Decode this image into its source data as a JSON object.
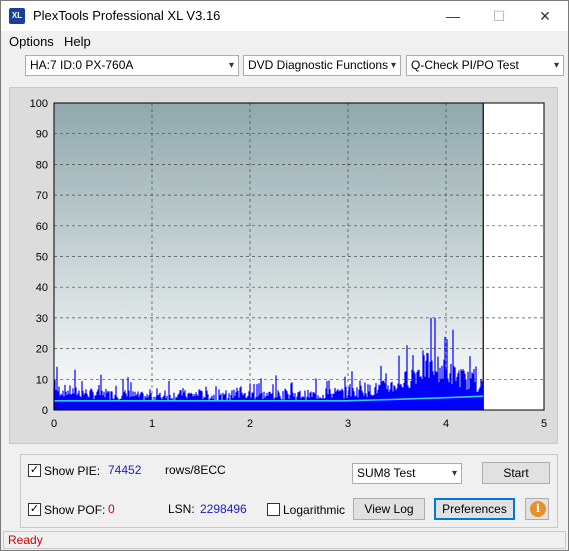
{
  "window": {
    "title": "PlexTools Professional XL V3.16",
    "icon_label": "XL",
    "minimize_glyph": "—",
    "maximize_glyph": "☐",
    "close_glyph": "✕"
  },
  "menu": {
    "options": "Options",
    "help": "Help"
  },
  "toolbar": {
    "drive": "HA:7 ID:0  PX-760A",
    "function": "DVD Diagnostic Functions",
    "test": "Q-Check PI/PO Test",
    "arrow": "▾"
  },
  "chart_data": {
    "type": "area",
    "x_range": [
      0,
      5
    ],
    "y_range": [
      0,
      100
    ],
    "x_ticks": [
      "0",
      "1",
      "2",
      "3",
      "4",
      "5"
    ],
    "y_ticks": [
      "0",
      "10",
      "20",
      "30",
      "40",
      "50",
      "60",
      "70",
      "80",
      "90",
      "100"
    ],
    "grid": true,
    "data_end_x": 4.38,
    "series": [
      {
        "type": "bars",
        "color": "#0000ff",
        "x": [
          0,
          0.25,
          0.5,
          0.75,
          1.0,
          1.25,
          1.5,
          1.75,
          2.0,
          2.25,
          2.5,
          2.75,
          3.0,
          3.25,
          3.5,
          3.6,
          3.7,
          3.8,
          3.9,
          4.0,
          4.1,
          4.2,
          4.3,
          4.38
        ],
        "y": [
          8,
          7,
          6,
          6,
          5,
          6,
          6,
          5,
          6,
          6,
          6,
          6,
          7,
          8,
          10,
          12,
          15,
          17,
          17,
          15,
          14,
          12,
          11,
          9
        ]
      },
      {
        "type": "line",
        "color": "#33ccff",
        "x": [
          0,
          1,
          2,
          3,
          3.5,
          4.0,
          4.38
        ],
        "y": [
          3,
          3,
          3,
          3,
          3.5,
          4,
          4.5
        ]
      }
    ]
  },
  "controls": {
    "show_pie_label": "Show PIE:",
    "pie_value": "74452",
    "pie_unit": "rows/8ECC",
    "show_pof_label": "Show POF:",
    "pof_value": "0",
    "lsn_label": "LSN:",
    "lsn_value": "2298496",
    "logarithmic_label": "Logarithmic",
    "test_select": "SUM8 Test",
    "start_button": "Start",
    "view_log_button": "View Log",
    "preferences_button": "Preferences",
    "info_glyph": "i",
    "check_glyph": "✓"
  },
  "status": {
    "text": "Ready"
  }
}
